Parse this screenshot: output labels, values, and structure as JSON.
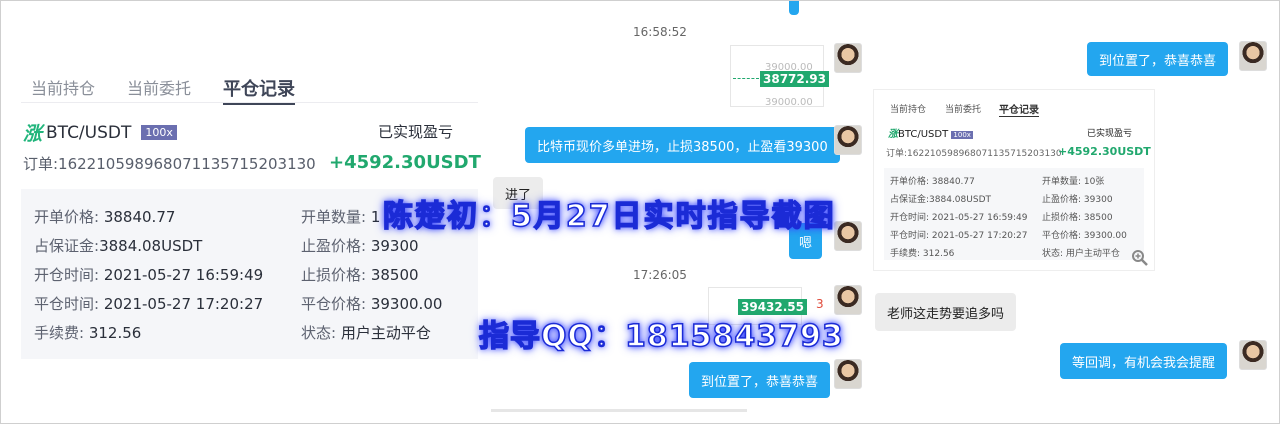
{
  "left_card": {
    "tabs": [
      "当前持仓",
      "当前委托",
      "平仓记录"
    ],
    "zhang": "涨",
    "pair": "BTC/USDT",
    "leverage": "100x",
    "pnl_label": "已实现盈亏",
    "order": "订单:1622105989680711357 15203130",
    "order_text": "订单:162210598968071135715203130",
    "pnl": "+4592.30USDT",
    "rows": [
      {
        "l1": "开单价格:",
        "v1": "38840.77",
        "l2": "开单数量:",
        "v2": "1"
      },
      {
        "l1": "占保证金:",
        "v1": "3884.08USDT",
        "l2": "止盈价格:",
        "v2": "39300"
      },
      {
        "l1": "开仓时间:",
        "v1": "2021-05-27 16:59:49",
        "l2": "止损价格:",
        "v2": "38500"
      },
      {
        "l1": "平仓时间:",
        "v1": "2021-05-27 17:20:27",
        "l2": "平仓价格:",
        "v2": "39300.00"
      },
      {
        "l1": "手续费:",
        "v1": "312.56",
        "l2": "状态:",
        "v2": "用户主动平仓"
      }
    ]
  },
  "chat": {
    "time1": "16:58:52",
    "price1": "38772.93",
    "price1_above": "39000.00",
    "price1_below": "39000.00",
    "bubble_top_right": "到位置了，恭喜恭喜",
    "bubble_call": "比特币现价多单进场，止损38500，止盈看39300",
    "bubble_jinle": "进了",
    "bubble_en": "嗯",
    "time2": "17:26:05",
    "price2": "39432.55",
    "side_num": "3",
    "bubble_question": "老师这走势要追多吗",
    "bubble_reply": "等回调，有机会我会提醒",
    "bubble_bottom": "到位置了，恭喜恭喜"
  },
  "small_card": {
    "tabs": [
      "当前持仓",
      "当前委托",
      "平仓记录"
    ],
    "pair": "BTC/USDT",
    "leverage": "100x",
    "pnl_label": "已实现盈亏",
    "order": "订单:162210598968071135715203130",
    "pnl": "+4592.30USDT",
    "rows": [
      {
        "l1": "开单价格:",
        "v1": "38840.77",
        "l2": "开单数量:",
        "v2": "10张"
      },
      {
        "l1": "占保证金:",
        "v1": "3884.08USDT",
        "l2": "止盈价格:",
        "v2": "39300"
      },
      {
        "l1": "开仓时间:",
        "v1": "2021-05-27 16:59:49",
        "l2": "止损价格:",
        "v2": "38500"
      },
      {
        "l1": "平仓时间:",
        "v1": "2021-05-27 17:20:27",
        "l2": "平仓价格:",
        "v2": "39300.00"
      },
      {
        "l1": "手续费:",
        "v1": "312.56",
        "l2": "状态:",
        "v2": "用户主动平仓"
      }
    ]
  },
  "overlay": {
    "title": "陈楚初：5月27日实时指导截图",
    "qq": "指导QQ：1815843793"
  },
  "colors": {
    "accent_blue": "#23a6ef",
    "profit_green": "#21a86e",
    "overlay_stroke": "#1b2bd6"
  },
  "icons": {
    "zoom": "zoom-in-icon"
  }
}
